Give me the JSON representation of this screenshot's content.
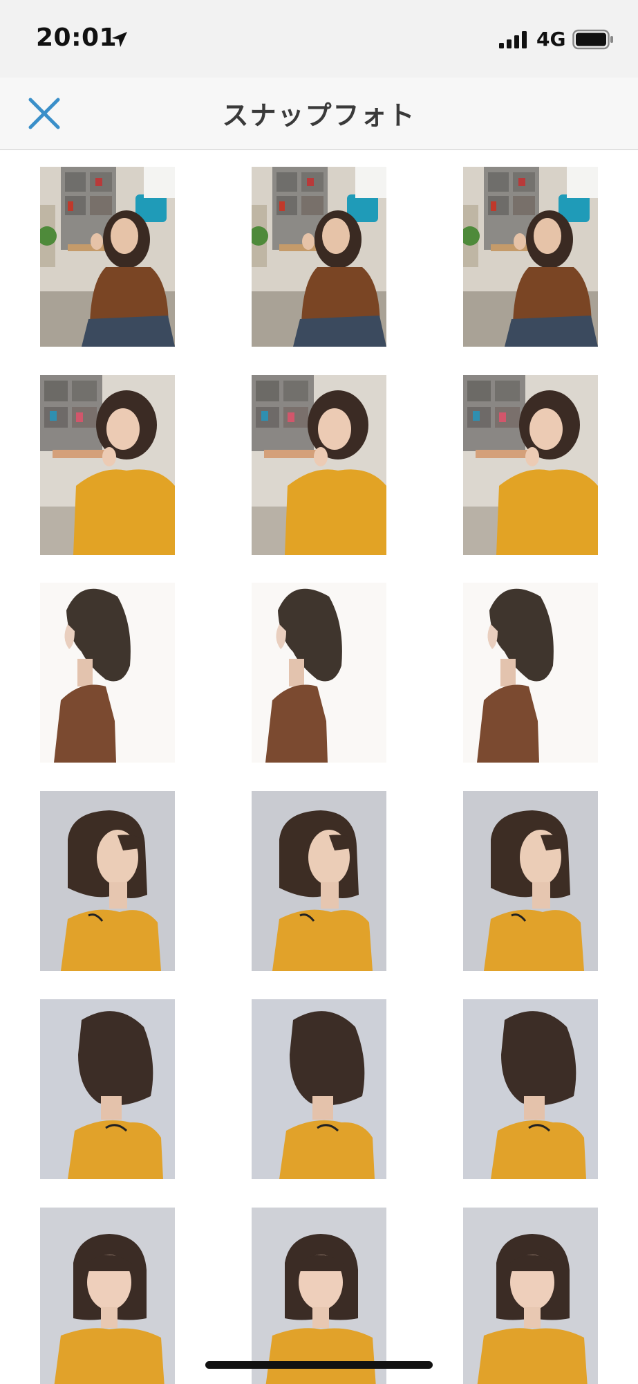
{
  "status_bar": {
    "time": "20:01",
    "network": "4G",
    "icons": [
      "location-arrow-icon",
      "signal-bars-icon",
      "battery-icon"
    ]
  },
  "nav": {
    "title": "スナップフォト",
    "close_icon": "close-icon",
    "accent_color": "#3a8fc9"
  },
  "photos": {
    "rows": [
      {
        "style": "studio-brown-top",
        "items": [
          "snap-1",
          "snap-2",
          "snap-3"
        ]
      },
      {
        "style": "studio-yellow-offshoulder",
        "items": [
          "snap-4",
          "snap-5",
          "snap-6"
        ]
      },
      {
        "style": "profile-wavy-brown",
        "items": [
          "snap-7",
          "snap-8",
          "snap-9"
        ]
      },
      {
        "style": "bob-side-yellow",
        "items": [
          "snap-10",
          "snap-11",
          "snap-12"
        ]
      },
      {
        "style": "bob-back-yellow",
        "items": [
          "snap-13",
          "snap-14",
          "snap-15"
        ]
      },
      {
        "style": "bob-front-yellow",
        "items": [
          "snap-16",
          "snap-17",
          "snap-18"
        ]
      }
    ]
  }
}
